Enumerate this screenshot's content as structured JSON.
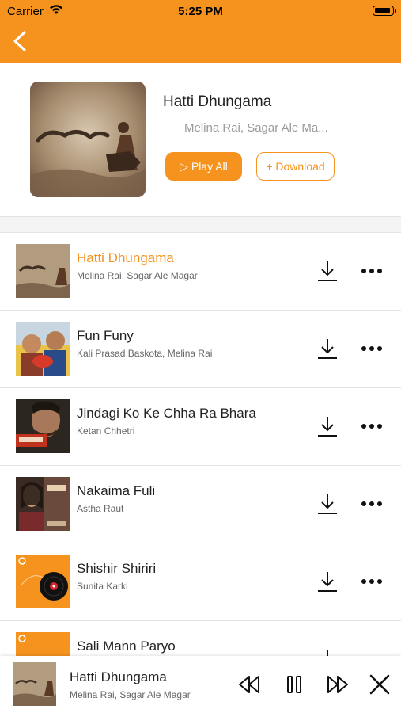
{
  "status_bar": {
    "carrier": "Carrier",
    "time": "5:25 PM"
  },
  "colors": {
    "accent": "#F5931E"
  },
  "album": {
    "title": "Hatti Dhungama",
    "artists": "Melina Rai, Sagar Ale Ma...",
    "play_all_label": "▷ Play All",
    "download_label": "+ Download"
  },
  "songs": [
    {
      "title": "Hatti Dhungama",
      "artist": "Melina Rai, Sagar Ale Magar",
      "active": true
    },
    {
      "title": "Fun Funy",
      "artist": "Kali Prasad Baskota, Melina Rai"
    },
    {
      "title": "Jindagi Ko Ke Chha Ra Bhara",
      "artist": "Ketan Chhetri"
    },
    {
      "title": "Nakaima Fuli",
      "artist": "Astha Raut"
    },
    {
      "title": "Shishir Shiriri",
      "artist": "Sunita Karki"
    },
    {
      "title": "Sali Mann Paryo",
      "artist": ""
    }
  ],
  "now_playing": {
    "title": "Hatti Dhungama",
    "artist": "Melina Rai, Sagar Ale Magar"
  },
  "icons": [
    "wifi-icon",
    "battery-icon",
    "back-icon",
    "download-icon",
    "more-icon",
    "rewind-icon",
    "pause-icon",
    "fast-forward-icon",
    "close-icon"
  ]
}
